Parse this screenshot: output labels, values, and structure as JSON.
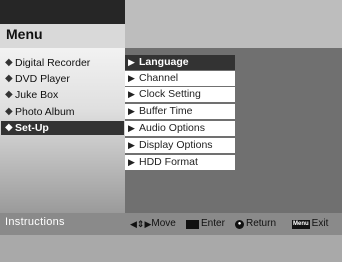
{
  "menu": {
    "title": "Menu",
    "items": [
      {
        "label": "Digital Recorder",
        "icon": "diamond-bullet-icon"
      },
      {
        "label": "DVD Player",
        "icon": "diamond-bullet-icon"
      },
      {
        "label": "Juke Box",
        "icon": "diamond-bullet-icon"
      },
      {
        "label": "Photo Album",
        "icon": "diamond-bullet-icon"
      },
      {
        "label": "Set-Up",
        "icon": "diamond-bullet-icon",
        "selected": true
      }
    ]
  },
  "submenu": {
    "items": [
      {
        "label": "Language",
        "icon": "arrow-bullet-icon",
        "selected": true
      },
      {
        "label": "Channel",
        "icon": "arrow-bullet-icon"
      },
      {
        "label": "Clock Setting",
        "icon": "arrow-bullet-icon"
      },
      {
        "label": "Buffer Time",
        "icon": "arrow-bullet-icon"
      },
      {
        "label": "Audio Options",
        "icon": "arrow-bullet-icon"
      },
      {
        "label": "Display Options",
        "icon": "arrow-bullet-icon"
      },
      {
        "label": "HDD Format",
        "icon": "arrow-bullet-icon"
      }
    ]
  },
  "instructions": {
    "label": "Instructions",
    "hints": [
      {
        "icon": "arrows-icon",
        "label": "Move"
      },
      {
        "icon": "enter-key-icon",
        "label": "Enter"
      },
      {
        "icon": "return-key-icon",
        "label": "Return"
      },
      {
        "icon": "menu-key-icon",
        "icon_text": "Menu",
        "label": "Exit"
      }
    ]
  },
  "colors": {
    "selected_bg": "#333333",
    "title_bar": "#262626",
    "panel_dark": "#707070",
    "instructions_bar": "#8a8a8a"
  }
}
